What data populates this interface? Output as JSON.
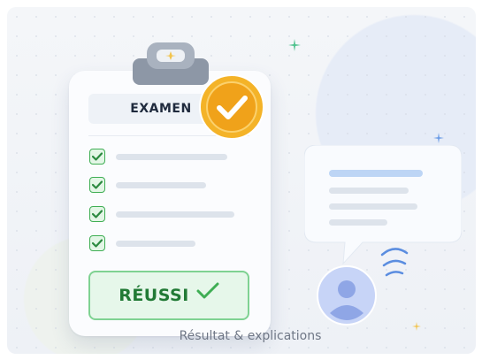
{
  "clipboard": {
    "title": "EXAMEN",
    "checklist_count": 4,
    "result_label": "RÉUSSI"
  },
  "caption": "Résultat & explications",
  "colors": {
    "success": "#3fae54",
    "badge_gold": "#f2a81a",
    "accent_blue": "#5b8de0"
  },
  "icons": [
    "clip-icon",
    "check-badge-icon",
    "checkbox-icon",
    "chat-bubble-icon",
    "user-avatar-icon",
    "wifi-waves-icon",
    "sparkle-icon"
  ]
}
